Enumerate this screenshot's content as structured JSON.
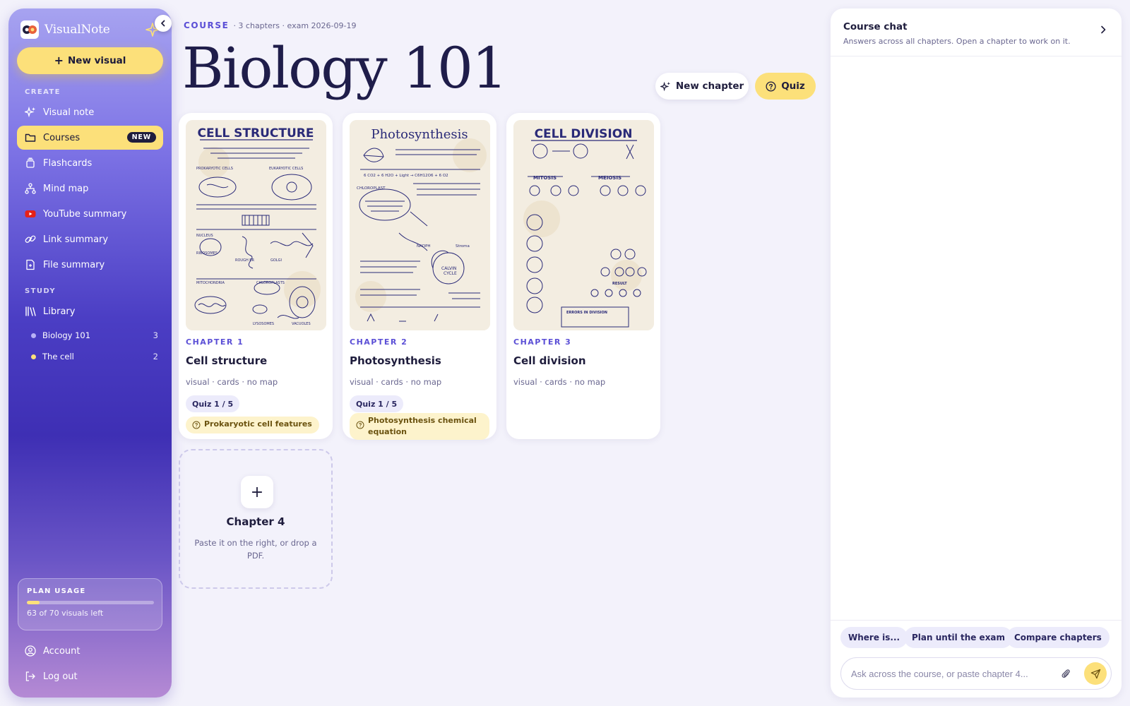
{
  "brand": {
    "name": "VisualNote"
  },
  "sidebar": {
    "new_visual": "New visual",
    "create_label": "CREATE",
    "create_items": [
      {
        "label": "Visual note",
        "icon": "sparkles-icon"
      },
      {
        "label": "Courses",
        "icon": "folder-icon",
        "badge": "NEW"
      },
      {
        "label": "Flashcards",
        "icon": "stack-icon"
      },
      {
        "label": "Mind map",
        "icon": "mindmap-icon"
      },
      {
        "label": "YouTube summary",
        "icon": "youtube-icon"
      },
      {
        "label": "Link summary",
        "icon": "link-icon"
      },
      {
        "label": "File summary",
        "icon": "file-icon"
      }
    ],
    "study_label": "STUDY",
    "library": {
      "label": "Library",
      "icon": "library-icon"
    },
    "library_items": [
      {
        "label": "Biology 101",
        "count": "3",
        "color": "#b9b2f5"
      },
      {
        "label": "The cell",
        "count": "2",
        "color": "#fce07a"
      }
    ],
    "usage": {
      "title": "PLAN USAGE",
      "text": "63 of 70 visuals left",
      "used_fraction": 0.1
    },
    "account": "Account",
    "logout": "Log out"
  },
  "course": {
    "kicker": "COURSE",
    "meta": "· 3 chapters · exam 2026-09-19",
    "title": "Biology 101",
    "new_chapter": "New chapter",
    "quiz": "Quiz"
  },
  "chapters": [
    {
      "kicker": "CHAPTER 1",
      "title": "Cell structure",
      "meta": "visual · cards · no map",
      "quiz": "Quiz 1 / 5",
      "topic": "Prokaryotic cell features",
      "thumb_heading": "CELL STRUCTURE"
    },
    {
      "kicker": "CHAPTER 2",
      "title": "Photosynthesis",
      "meta": "visual · cards · no map",
      "quiz": "Quiz 1 / 5",
      "topic": "Photosynthesis chemical equation",
      "thumb_heading": "Photosynthesis"
    },
    {
      "kicker": "CHAPTER 3",
      "title": "Cell division",
      "meta": "visual · cards · no map",
      "thumb_heading": "CELL DIVISION"
    }
  ],
  "add_chapter": {
    "plus": "+",
    "title": "Chapter 4",
    "desc": "Paste it on the right, or drop a PDF."
  },
  "chat": {
    "title": "Course chat",
    "subtitle": "Answers across all chapters. Open a chapter to work on it.",
    "chips": [
      "Where is...",
      "Plan until the exam",
      "Compare chapters"
    ],
    "placeholder": "Ask across the course, or paste chapter 4..."
  },
  "colors": {
    "accent": "#5b4fd6",
    "yellow": "#fce07a",
    "ink": "#1f1d3d"
  }
}
